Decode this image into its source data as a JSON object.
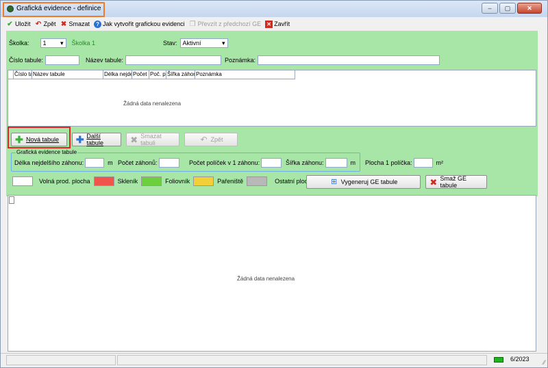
{
  "window": {
    "title": "Grafická evidence - definice",
    "min": "–",
    "max": "▢",
    "close": "✕"
  },
  "toolbar": {
    "save": "Uložit",
    "back": "Zpět",
    "delete": "Smazat",
    "howto": "Jak vytvořit grafickou evidenci",
    "copy_prev": "Převzít z předchozí GE",
    "close": "Zavřít"
  },
  "filters": {
    "school_label": "Školka:",
    "school_value": "1",
    "school_name": "Školka 1",
    "state_label": "Stav:",
    "state_value": "Aktivní",
    "table_no_label": "Číslo tabule:",
    "table_name_label": "Název tabule:",
    "note_label": "Poznámka:"
  },
  "grid1": {
    "columns": [
      "Číslo tabule",
      "Název tabule",
      "Délka nejdelšího",
      "Počet",
      "Poč. p",
      "Šířka záhonu",
      "Poznámka"
    ],
    "empty": "Žádná data nenalezena"
  },
  "buttons": {
    "new": "Nová tabule",
    "next": "Další tabule",
    "delete": "Smazat tabuli",
    "back": "Zpět"
  },
  "ge": {
    "legend": "Grafická evidence tabule",
    "length_label": "Délka nejdelšího záhonu:",
    "m1": "m",
    "count_label": "Počet záhonů:",
    "cells_label": "Počet políček v 1 záhonu:",
    "width_label": "Šířka záhonu:",
    "m2": "m",
    "area_label": "Plocha 1 políčka:",
    "m2unit": "m²"
  },
  "legend_row": {
    "free": "Volná prod. plocha",
    "greenhouse": "Skleník",
    "foil": "Foliovník",
    "hotbed": "Pařeniště",
    "other": "Ostatní plocha",
    "generate": "Vygeneruj GE tabule",
    "delete_ge": "Smaž GE tabule"
  },
  "colors": {
    "free": "#ffffff",
    "greenhouse": "#f0544a",
    "foil": "#6ccf3e",
    "hotbed": "#f3d03a",
    "other": "#b8b8b8"
  },
  "grid2": {
    "empty": "Žádná data nenalezena"
  },
  "status": {
    "period": "6/2023"
  }
}
